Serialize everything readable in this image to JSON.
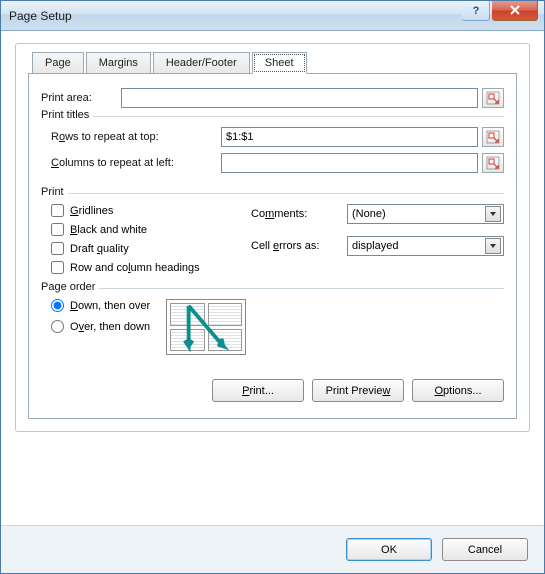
{
  "window": {
    "title": "Page Setup"
  },
  "tabs": {
    "page": "Page",
    "margins": "Margins",
    "headerfooter": "Header/Footer",
    "sheet": "Sheet"
  },
  "printArea": {
    "label": "Print area:",
    "value": ""
  },
  "printTitles": {
    "legend": "Print titles",
    "rowsLabel_pre": "R",
    "rowsLabel_u": "o",
    "rowsLabel_post": "ws to repeat at top:",
    "rowsValue": "$1:$1",
    "colsLabel_pre": "",
    "colsLabel_u": "C",
    "colsLabel_post": "olumns to repeat at left:",
    "colsValue": ""
  },
  "print": {
    "legend": "Print",
    "gridlines_pre": "",
    "gridlines_u": "G",
    "gridlines_post": "ridlines",
    "bw_pre": "",
    "bw_u": "B",
    "bw_post": "lack and white",
    "draft_pre": "Draft ",
    "draft_u": "q",
    "draft_post": "uality",
    "rch_pre": "Row and co",
    "rch_u": "l",
    "rch_post": "umn headings",
    "commentsLabel_pre": "Co",
    "commentsLabel_u": "m",
    "commentsLabel_post": "ments:",
    "commentsValue": "(None)",
    "cellErrLabel_pre": "Cell ",
    "cellErrLabel_u": "e",
    "cellErrLabel_post": "rrors as:",
    "cellErrValue": "displayed"
  },
  "pageOrder": {
    "legend": "Page order",
    "down_pre": "",
    "down_u": "D",
    "down_post": "own, then over",
    "over_pre": "O",
    "over_u": "v",
    "over_post": "er, then down",
    "selected": "down"
  },
  "buttons": {
    "print": "Print...",
    "preview_pre": "Print Previe",
    "preview_u": "w",
    "preview_post": "",
    "options_pre": "",
    "options_u": "O",
    "options_post": "ptions...",
    "ok": "OK",
    "cancel": "Cancel"
  }
}
